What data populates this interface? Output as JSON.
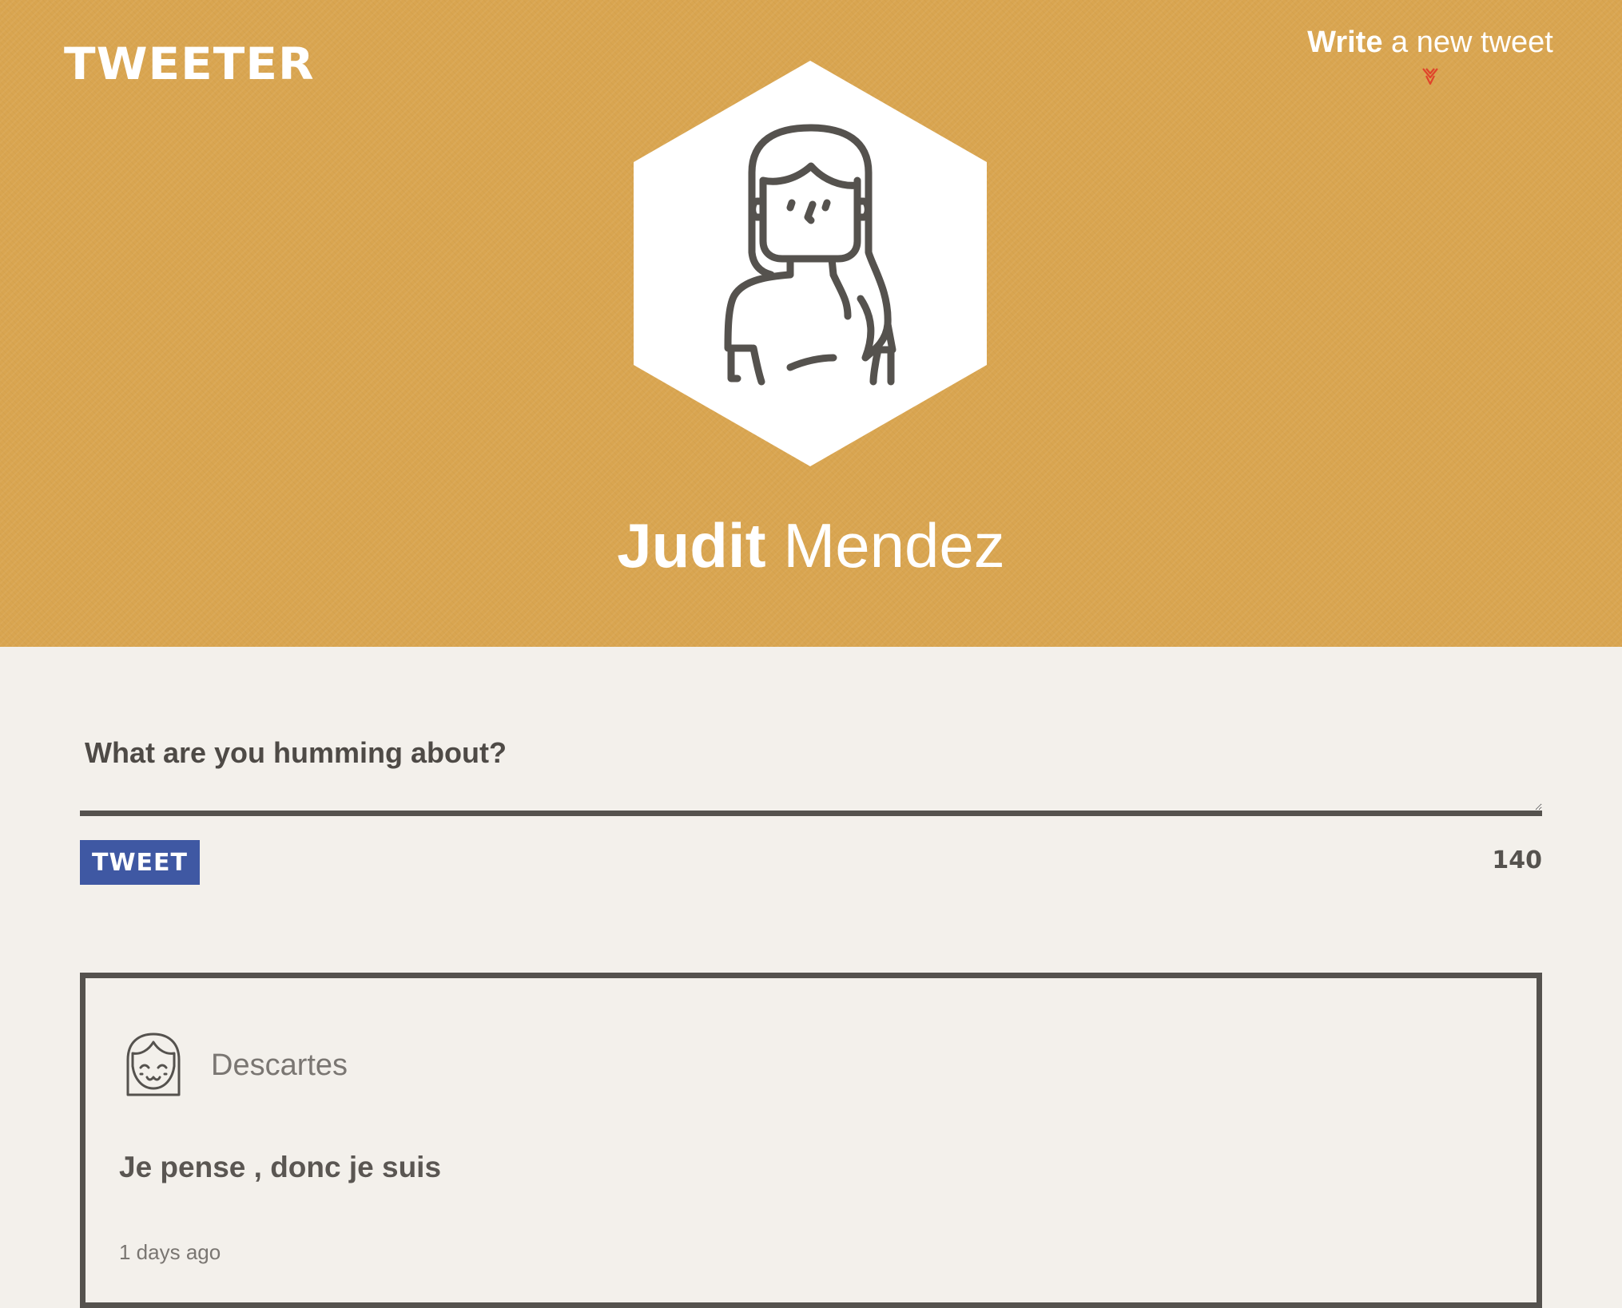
{
  "header": {
    "logo": "TWEETER",
    "compose_toggle": {
      "bold": "Write",
      "rest": "a new tweet",
      "icon": "double-chevron-down-icon"
    },
    "profile": {
      "first_name": "Judit",
      "last_name": "Mendez",
      "avatar": "female-user-avatar-icon"
    }
  },
  "composer": {
    "placeholder": "What are you humming about?",
    "value": "",
    "button_label": "TWEET",
    "char_counter": "140"
  },
  "tweets": [
    {
      "author": "Descartes",
      "avatar": "smiling-face-avatar-icon",
      "text": "Je pense , donc je suis",
      "time": "1 days ago"
    }
  ],
  "colors": {
    "header_bg": "#d9a550",
    "page_bg": "#f3f0eb",
    "button_bg": "#3f58a3",
    "ink": "#55524e",
    "accent_red": "#e0442b"
  }
}
